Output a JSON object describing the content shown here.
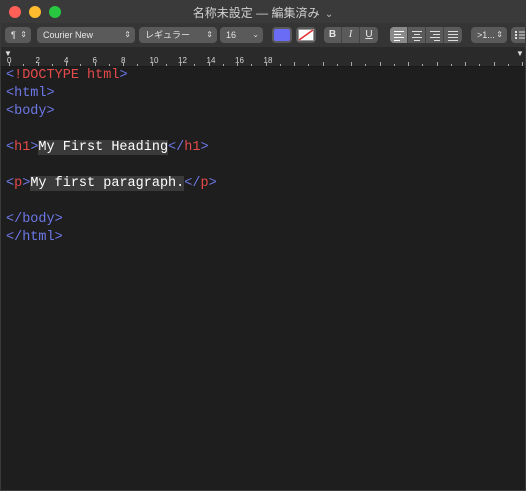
{
  "window": {
    "title": "名称未設定 — 編集済み",
    "title_chevron": "⌄"
  },
  "toolbar": {
    "paragraph_label": "¶",
    "font_family": "Courier New",
    "font_style": "レギュラー",
    "font_size": "16",
    "text_color": "#6a6cf5",
    "bold_label": "B",
    "italic_label": "I",
    "underline_label": "U",
    "spacing_label": ">1..."
  },
  "ruler": {
    "marks": [
      "0",
      "2",
      "4",
      "6",
      "8",
      "10",
      "12",
      "14",
      "16",
      "18"
    ]
  },
  "editor": {
    "lines": [
      {
        "parts": [
          {
            "c": "tag",
            "t": "<"
          },
          {
            "c": "tn",
            "t": "!DOCTYPE html"
          },
          {
            "c": "tag",
            "t": ">"
          }
        ]
      },
      {
        "parts": [
          {
            "c": "tag",
            "t": "<html>"
          }
        ]
      },
      {
        "parts": [
          {
            "c": "tag",
            "t": "<body>"
          }
        ]
      },
      {
        "parts": []
      },
      {
        "parts": [
          {
            "c": "tag",
            "t": "<"
          },
          {
            "c": "tn",
            "t": "h1"
          },
          {
            "c": "tag",
            "t": ">"
          },
          {
            "c": "txt",
            "t": "My First Heading"
          },
          {
            "c": "tag",
            "t": "</"
          },
          {
            "c": "tn",
            "t": "h1"
          },
          {
            "c": "tag",
            "t": ">"
          }
        ]
      },
      {
        "parts": []
      },
      {
        "parts": [
          {
            "c": "tag",
            "t": "<"
          },
          {
            "c": "tn",
            "t": "p"
          },
          {
            "c": "tag",
            "t": ">"
          },
          {
            "c": "txt",
            "t": "My first paragraph."
          },
          {
            "c": "tag",
            "t": "</"
          },
          {
            "c": "tn",
            "t": "p"
          },
          {
            "c": "tag",
            "t": ">"
          }
        ]
      },
      {
        "parts": []
      },
      {
        "parts": [
          {
            "c": "tag",
            "t": "</body>"
          }
        ]
      },
      {
        "parts": [
          {
            "c": "tag",
            "t": "</html>"
          }
        ]
      }
    ]
  }
}
